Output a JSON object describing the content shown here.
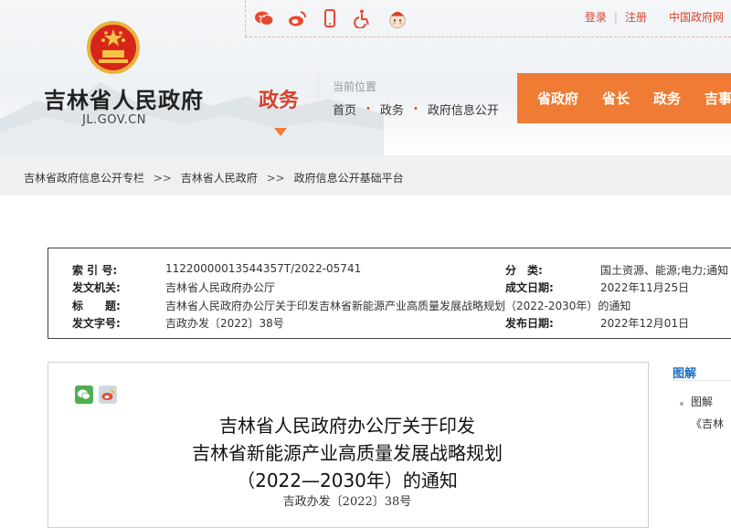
{
  "top_links": {
    "login": "登录",
    "register": "注册",
    "gov_portal": "中国政府网"
  },
  "site": {
    "name": "吉林省人民政府",
    "domain": "JL.GOV.CN"
  },
  "section": "政务",
  "location": {
    "label": "当前位置",
    "crumbs": [
      "首页",
      "政务",
      "政府信息公开"
    ]
  },
  "nav": [
    "省政府",
    "省长",
    "政务",
    "吉事"
  ],
  "breadcrumb2": [
    "吉林省政府信息公开专栏",
    "吉林省人民政府",
    "政府信息公开基础平台"
  ],
  "breadcrumb2_sep": ">>",
  "meta": {
    "index_label": "索 引 号:",
    "index_value": "11220000013544357T/2022-05741",
    "org_label": "发文机关:",
    "org_value": "吉林省人民政府办公厅",
    "title_label": "标　　题:",
    "title_value": "吉林省人民政府办公厅关于印发吉林省新能源产业高质量发展战略规划（2022-2030年）的通知",
    "docno_label": "发文字号:",
    "docno_value": "吉政办发〔2022〕38号",
    "category_label": "分　类:",
    "category_value": "国土资源、能源;电力;通知",
    "date_label": "成文日期:",
    "date_value": "2022年11月25日",
    "pub_label": "发布日期:",
    "pub_value": "2022年12月01日"
  },
  "document": {
    "title_line1": "吉林省人民政府办公厅关于印发",
    "title_line2": "吉林省新能源产业高质量发展战略规划",
    "title_line3": "（2022—2030年）的通知",
    "doc_number": "吉政办发〔2022〕38号"
  },
  "side": {
    "title": "图解",
    "item": "图解《吉林省新能源产业高质量发展战略规划》"
  },
  "colors": {
    "brand_red": "#d9412c",
    "nav_orange": "#ef7b34",
    "link_blue": "#1a6fc4"
  }
}
